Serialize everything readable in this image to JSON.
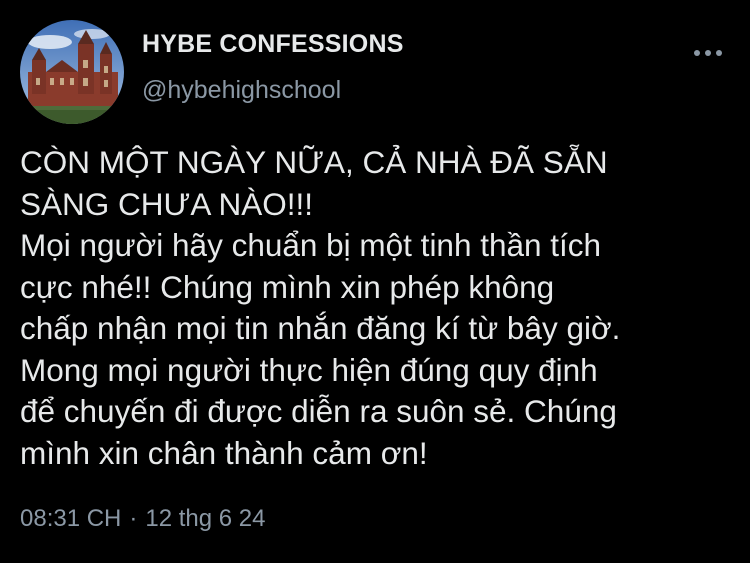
{
  "tweet": {
    "author": {
      "display_name": "HYBE CONFESSIONS",
      "handle": "@hybehighschool",
      "avatar_icon": "school-building-avatar"
    },
    "more_icon": "more-horizontal-icon",
    "text": "CÒN MỘT NGÀY NỮA, CẢ NHÀ ĐÃ SẴN\nSÀNG CHƯA NÀO!!!\nMọi người hãy chuẩn bị một tinh thần tích\ncực nhé!! Chúng mình xin phép không\nchấp nhận mọi tin nhắn đăng kí từ bây giờ.\nMong mọi người thực hiện đúng quy định\nđể chuyến đi được diễn ra suôn sẻ. Chúng\nmình xin chân thành cảm ơn!",
    "time": "08:31 CH",
    "separator": "·",
    "date": "12 thg 6 24"
  },
  "colors": {
    "background": "#000000",
    "primary_text": "#e7e9ea",
    "secondary_text": "#8b98a5"
  }
}
